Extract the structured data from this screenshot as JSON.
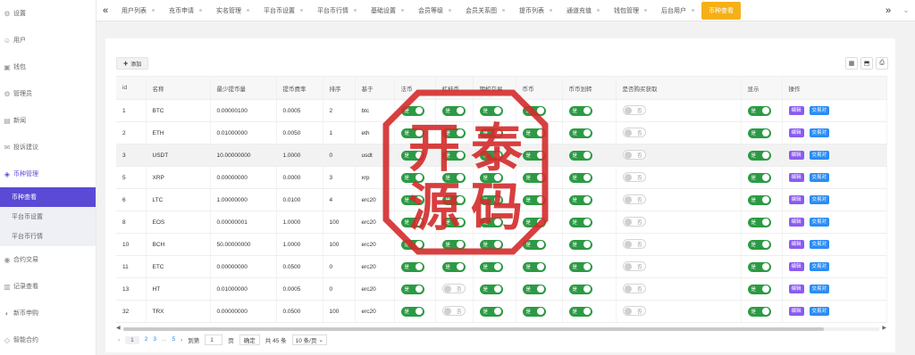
{
  "sidebar": {
    "items": [
      {
        "icon": "gear-icon",
        "label": "设置"
      },
      {
        "icon": "user-icon",
        "label": "用户"
      },
      {
        "icon": "wallet-icon",
        "label": "钱包"
      },
      {
        "icon": "gear-icon",
        "label": "管理员"
      },
      {
        "icon": "news-icon",
        "label": "新闻"
      },
      {
        "icon": "feedback-icon",
        "label": "投诉建议"
      },
      {
        "icon": "coin-icon",
        "label": "币种管理"
      }
    ],
    "subitems": [
      {
        "label": "币种查看"
      },
      {
        "label": "平台币设置"
      },
      {
        "label": "平台币行情"
      }
    ],
    "items_after": [
      {
        "icon": "contract-icon",
        "label": "合约交易"
      },
      {
        "icon": "record-icon",
        "label": "记录查看"
      },
      {
        "icon": "ipo-icon",
        "label": "新币申购"
      },
      {
        "icon": "smart-icon",
        "label": "智能合约"
      }
    ]
  },
  "topbar": {
    "tabs": [
      "用户列表",
      "充币申请",
      "实名管理",
      "平台币设置",
      "平台币行情",
      "基础设置",
      "会员等级",
      "会员关系图",
      "提币列表",
      "通道充值",
      "钱包管理",
      "后台用户",
      "币种查看"
    ],
    "active_tab": "币种查看"
  },
  "toolbar": {
    "add_label": "添加"
  },
  "table": {
    "columns": [
      "id",
      "名称",
      "最少提币量",
      "提币费率",
      "排序",
      "基于",
      "法币",
      "杠杆币",
      "期权交易",
      "币币",
      "币币划转",
      "是否购买获取",
      "显示",
      "操作"
    ],
    "rows": [
      {
        "id": "1",
        "name": "BTC",
        "min": "0.00000100",
        "rate": "0.0005",
        "sort": "2",
        "base": "btc",
        "fiat": "on",
        "lever": "on",
        "option": "on",
        "coin": "on",
        "transfer": "on",
        "buy": "off",
        "show": "on"
      },
      {
        "id": "2",
        "name": "ETH",
        "min": "0.01000000",
        "rate": "0.0050",
        "sort": "1",
        "base": "eth",
        "fiat": "on",
        "lever": "on",
        "option": "on",
        "coin": "on",
        "transfer": "on",
        "buy": "off",
        "show": "on"
      },
      {
        "id": "3",
        "name": "USDT",
        "min": "10.00000000",
        "rate": "1.0000",
        "sort": "0",
        "base": "usdt",
        "fiat": "on",
        "lever": "on",
        "option": "on",
        "coin": "on",
        "transfer": "on",
        "buy": "off",
        "show": "on"
      },
      {
        "id": "5",
        "name": "XRP",
        "min": "0.00000000",
        "rate": "0.0000",
        "sort": "3",
        "base": "xrp",
        "fiat": "on",
        "lever": "on",
        "option": "on",
        "coin": "on",
        "transfer": "on",
        "buy": "off",
        "show": "on"
      },
      {
        "id": "6",
        "name": "LTC",
        "min": "1.00000000",
        "rate": "0.0100",
        "sort": "4",
        "base": "erc20",
        "fiat": "on",
        "lever": "on",
        "option": "on",
        "coin": "on",
        "transfer": "on",
        "buy": "off",
        "show": "on"
      },
      {
        "id": "8",
        "name": "EOS",
        "min": "0.00000001",
        "rate": "1.0000",
        "sort": "100",
        "base": "erc20",
        "fiat": "on",
        "lever": "on",
        "option": "on",
        "coin": "on",
        "transfer": "on",
        "buy": "off",
        "show": "on"
      },
      {
        "id": "10",
        "name": "BCH",
        "min": "50.00000000",
        "rate": "1.0000",
        "sort": "100",
        "base": "erc20",
        "fiat": "on",
        "lever": "on",
        "option": "on",
        "coin": "on",
        "transfer": "on",
        "buy": "off",
        "show": "on"
      },
      {
        "id": "11",
        "name": "ETC",
        "min": "0.00000000",
        "rate": "0.0500",
        "sort": "0",
        "base": "erc20",
        "fiat": "on",
        "lever": "on",
        "option": "on",
        "coin": "on",
        "transfer": "on",
        "buy": "off",
        "show": "on"
      },
      {
        "id": "13",
        "name": "HT",
        "min": "0.01000000",
        "rate": "0.0005",
        "sort": "0",
        "base": "erc20",
        "fiat": "on",
        "lever": "off",
        "option": "on",
        "coin": "on",
        "transfer": "on",
        "buy": "off",
        "show": "on"
      },
      {
        "id": "32",
        "name": "TRX",
        "min": "0.00000000",
        "rate": "0.0500",
        "sort": "100",
        "base": "erc20",
        "fiat": "on",
        "lever": "off",
        "option": "on",
        "coin": "on",
        "transfer": "on",
        "buy": "off",
        "show": "on"
      }
    ],
    "switch_on_label": "是",
    "switch_off_label": "否",
    "edit_label": "编辑",
    "pair_label": "交易对"
  },
  "pager": {
    "pages": [
      "1",
      "2",
      "3",
      "...",
      "5"
    ],
    "current": "1",
    "goto_label": "到第",
    "goto_value": "1",
    "page_unit": "页",
    "confirm_label": "确定",
    "total_label": "共 45 条",
    "per_page": "10 条/页"
  },
  "stamp": {
    "chars": [
      "开",
      "泰",
      "源",
      "码"
    ],
    "color": "#d42b2b"
  },
  "colors": {
    "accent": "#5b4ad6",
    "active_tab": "#f5b018",
    "switch_on": "#2c9a44",
    "edit": "#8a5cf0",
    "pair": "#2a8df3"
  }
}
